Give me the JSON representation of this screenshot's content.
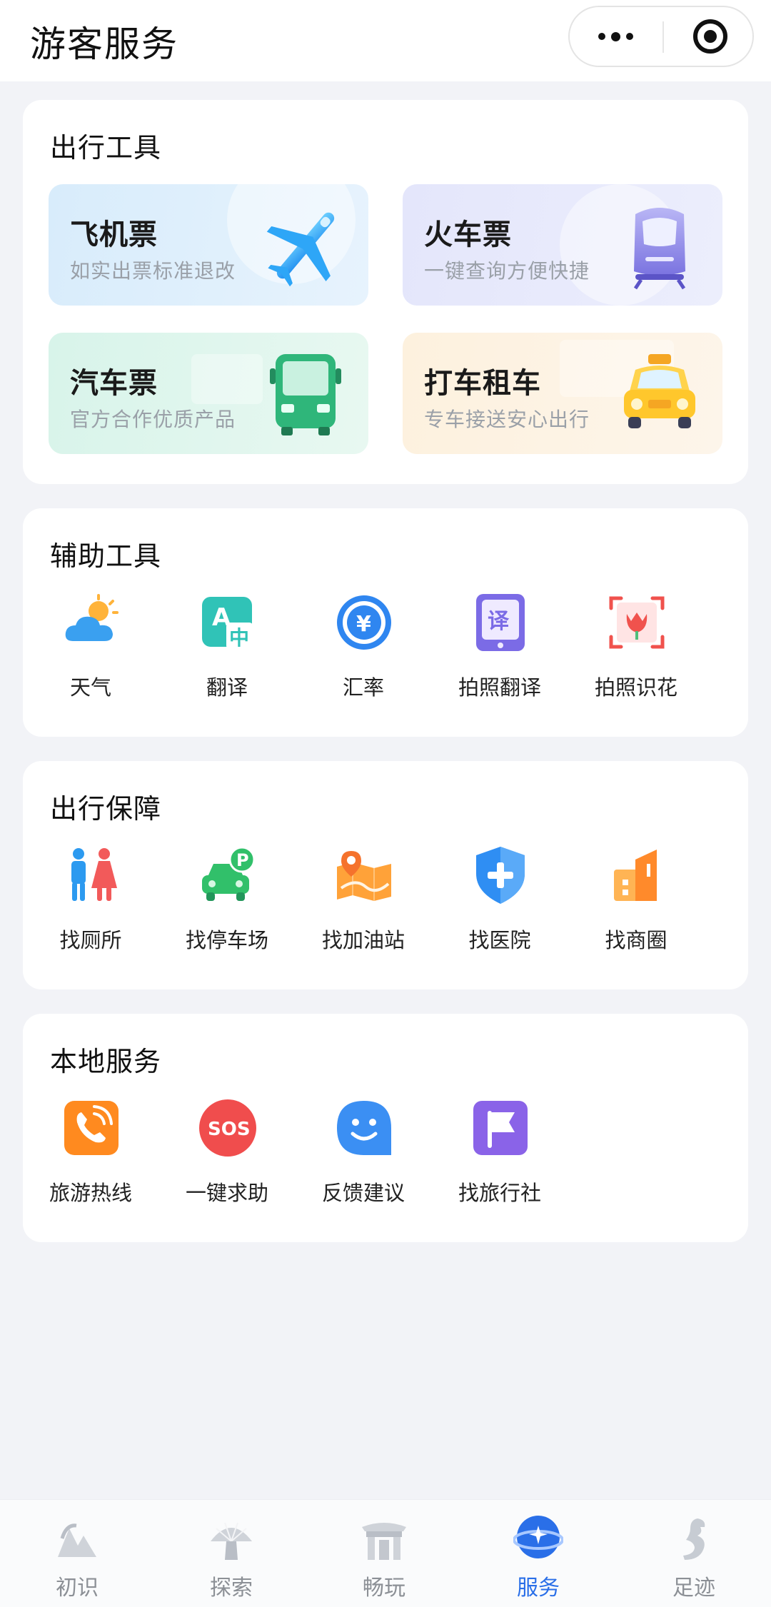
{
  "header": {
    "title": "游客服务"
  },
  "travel": {
    "title": "出行工具",
    "tiles": [
      {
        "title": "飞机票",
        "sub": "如实出票标准退改",
        "icon": "airplane-icon"
      },
      {
        "title": "火车票",
        "sub": "一键查询方便快捷",
        "icon": "train-icon"
      },
      {
        "title": "汽车票",
        "sub": "官方合作优质产品",
        "icon": "bus-icon"
      },
      {
        "title": "打车租车",
        "sub": "专车接送安心出行",
        "icon": "taxi-icon"
      }
    ]
  },
  "aux": {
    "title": "辅助工具",
    "items": [
      {
        "label": "天气",
        "icon": "weather-icon"
      },
      {
        "label": "翻译",
        "icon": "translate-icon"
      },
      {
        "label": "汇率",
        "icon": "currency-icon"
      },
      {
        "label": "拍照翻译",
        "icon": "photo-translate-icon"
      },
      {
        "label": "拍照识花",
        "icon": "flower-scan-icon"
      }
    ]
  },
  "safety": {
    "title": "出行保障",
    "items": [
      {
        "label": "找厕所",
        "icon": "toilet-icon"
      },
      {
        "label": "找停车场",
        "icon": "parking-icon"
      },
      {
        "label": "找加油站",
        "icon": "gas-station-icon"
      },
      {
        "label": "找医院",
        "icon": "hospital-icon"
      },
      {
        "label": "找商圈",
        "icon": "shopping-district-icon"
      }
    ]
  },
  "local": {
    "title": "本地服务",
    "items": [
      {
        "label": "旅游热线",
        "icon": "hotline-icon"
      },
      {
        "label": "一键求助",
        "icon": "sos-icon"
      },
      {
        "label": "反馈建议",
        "icon": "feedback-icon"
      },
      {
        "label": "找旅行社",
        "icon": "travel-agency-icon"
      }
    ]
  },
  "tabbar": {
    "items": [
      {
        "label": "初识"
      },
      {
        "label": "探索"
      },
      {
        "label": "畅玩"
      },
      {
        "label": "服务"
      },
      {
        "label": "足迹"
      }
    ],
    "active_color": "#2a6fe8",
    "inactive_color": "#8c9096"
  }
}
